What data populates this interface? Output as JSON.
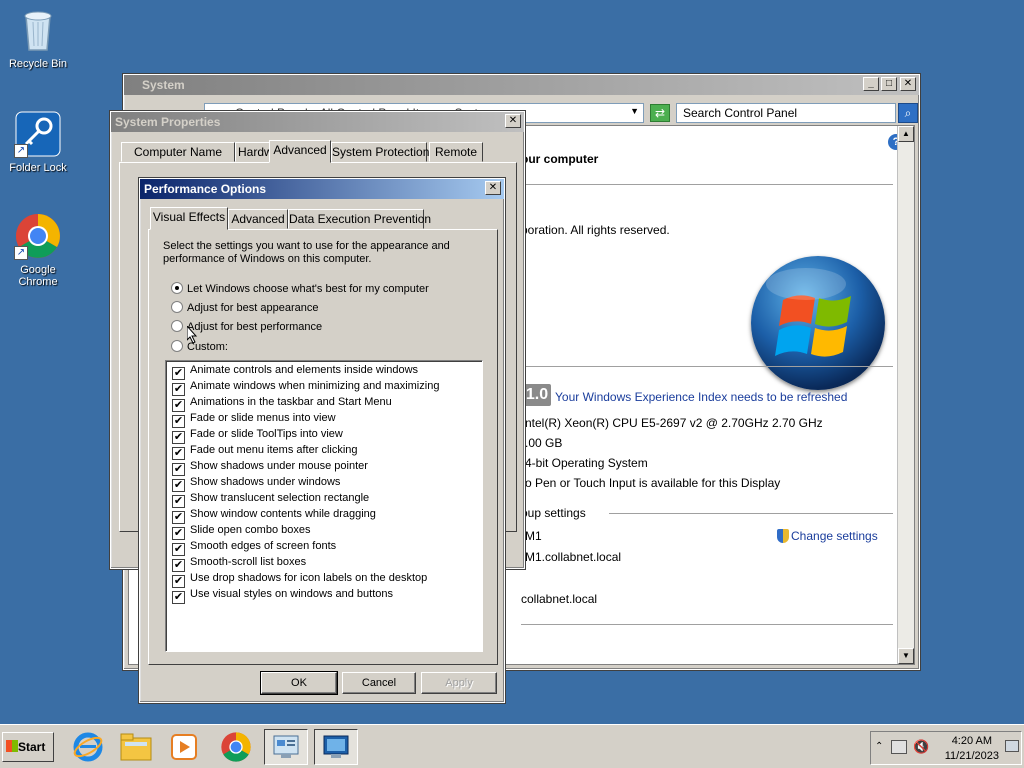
{
  "desktop": {
    "icons": [
      {
        "label": "Recycle Bin"
      },
      {
        "label": "Folder Lock"
      },
      {
        "label": "Google Chrome"
      }
    ]
  },
  "system_window": {
    "title": "System",
    "address_text": "Control Panel ▸ All Control Panel Items ▸ System",
    "search_placeholder": "Search Control Panel",
    "heading": "our computer",
    "copyright": "poration.  All rights reserved.",
    "wei_score": "1.0",
    "wei_link": "Your Windows Experience Index needs to be refreshed",
    "processor": "ntel(R) Xeon(R) CPU E5-2697 v2 @ 2.70GHz   2.70 GHz",
    "memory": ".00 GB",
    "system_type": "4-bit Operating System",
    "pen_touch": "o Pen or Touch Input is available for this Display",
    "group_header": "oup settings",
    "computer_name": "M1",
    "full_name": "M1.collabnet.local",
    "domain": "collabnet.local",
    "change_settings": "Change settings"
  },
  "sysprops": {
    "title": "System Properties",
    "tabs": [
      "Computer Name",
      "Hardware",
      "Advanced",
      "System Protection",
      "Remote"
    ],
    "selected_tab": "Advanced"
  },
  "perf": {
    "title": "Performance Options",
    "tabs": [
      "Visual Effects",
      "Advanced",
      "Data Execution Prevention"
    ],
    "selected_tab": "Visual Effects",
    "description": "Select the settings you want to use for the appearance and performance of Windows on this computer.",
    "radios": [
      {
        "label": "Let Windows choose what's best for my computer",
        "selected": true
      },
      {
        "label": "Adjust for best appearance",
        "selected": false
      },
      {
        "label": "Adjust for best performance",
        "selected": false
      },
      {
        "label": "Custom:",
        "selected": false
      }
    ],
    "effects": [
      {
        "label": "Animate controls and elements inside windows",
        "checked": true
      },
      {
        "label": "Animate windows when minimizing and maximizing",
        "checked": true
      },
      {
        "label": "Animations in the taskbar and Start Menu",
        "checked": true
      },
      {
        "label": "Fade or slide menus into view",
        "checked": true
      },
      {
        "label": "Fade or slide ToolTips into view",
        "checked": true
      },
      {
        "label": "Fade out menu items after clicking",
        "checked": true
      },
      {
        "label": "Show shadows under mouse pointer",
        "checked": true
      },
      {
        "label": "Show shadows under windows",
        "checked": true
      },
      {
        "label": "Show translucent selection rectangle",
        "checked": true
      },
      {
        "label": "Show window contents while dragging",
        "checked": true
      },
      {
        "label": "Slide open combo boxes",
        "checked": true
      },
      {
        "label": "Smooth edges of screen fonts",
        "checked": true
      },
      {
        "label": "Smooth-scroll list boxes",
        "checked": true
      },
      {
        "label": "Use drop shadows for icon labels on the desktop",
        "checked": true
      },
      {
        "label": "Use visual styles on windows and buttons",
        "checked": true
      }
    ],
    "ok": "OK",
    "cancel": "Cancel",
    "apply": "Apply"
  },
  "taskbar": {
    "start": "Start",
    "apps": [
      "internet-explorer",
      "windows-explorer",
      "media-player",
      "google-chrome",
      "server-manager",
      "control-panel-system"
    ],
    "time": "4:20 AM",
    "date": "11/21/2023"
  },
  "colors": {
    "desktop": "#3a6ea5",
    "active_title_start": "#0a246a",
    "active_title_end": "#a6caf0",
    "inactive_title_start": "#808080",
    "inactive_title_end": "#c0c0c0"
  }
}
